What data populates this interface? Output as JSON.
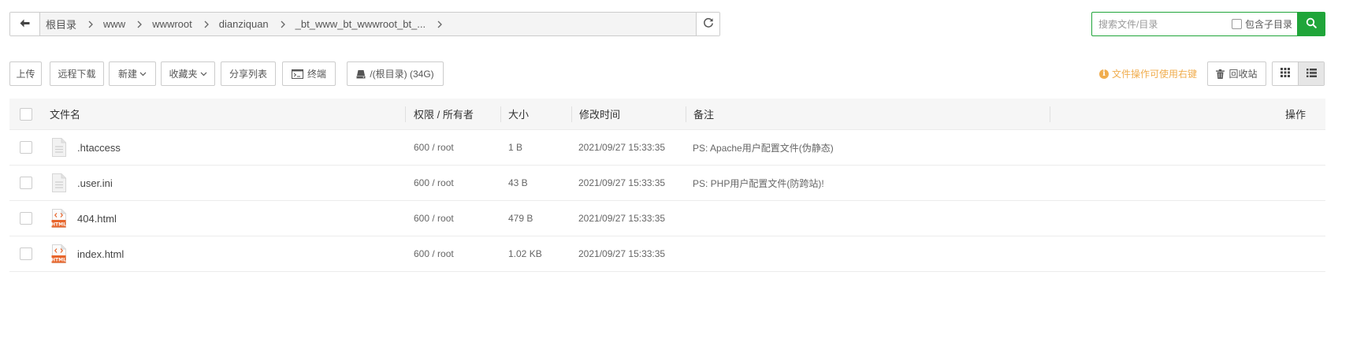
{
  "pathbar": {
    "back_icon": "arrow-left-icon",
    "crumbs": [
      "根目录",
      "www",
      "wwwroot",
      "dianziquan",
      "_bt_www_bt_wwwroot_bt_..."
    ],
    "refresh_icon": "refresh-icon"
  },
  "search": {
    "placeholder": "搜索文件/目录",
    "value": "",
    "include_sub_label": "包含子目录",
    "include_sub_checked": false,
    "button_icon": "search-icon"
  },
  "toolbar": {
    "upload": "上传",
    "remote_download": "远程下载",
    "new": "新建",
    "favorites": "收藏夹",
    "share_list": "分享列表",
    "terminal": "终端",
    "disk": "/(根目录) (34G)",
    "tip": "文件操作可使用右键",
    "recycle_bin": "回收站",
    "view_mode": "list"
  },
  "table": {
    "headers": {
      "name": "文件名",
      "perm": "权限 / 所有者",
      "size": "大小",
      "mtime": "修改时间",
      "note": "备注",
      "ops": "操作"
    },
    "rows": [
      {
        "name": ".htaccess",
        "type": "file",
        "perm": "600 / root",
        "size": "1 B",
        "mtime": "2021/09/27 15:33:35",
        "note": "PS: Apache用户配置文件(伪静态)"
      },
      {
        "name": ".user.ini",
        "type": "file",
        "perm": "600 / root",
        "size": "43 B",
        "mtime": "2021/09/27 15:33:35",
        "note": "PS: PHP用户配置文件(防跨站)!"
      },
      {
        "name": "404.html",
        "type": "html",
        "perm": "600 / root",
        "size": "479 B",
        "mtime": "2021/09/27 15:33:35",
        "note": ""
      },
      {
        "name": "index.html",
        "type": "html",
        "perm": "600 / root",
        "size": "1.02 KB",
        "mtime": "2021/09/27 15:33:35",
        "note": ""
      }
    ]
  },
  "colors": {
    "accent": "#20a53a",
    "tip": "#f0ad4e",
    "html_icon": "#e8652b"
  }
}
